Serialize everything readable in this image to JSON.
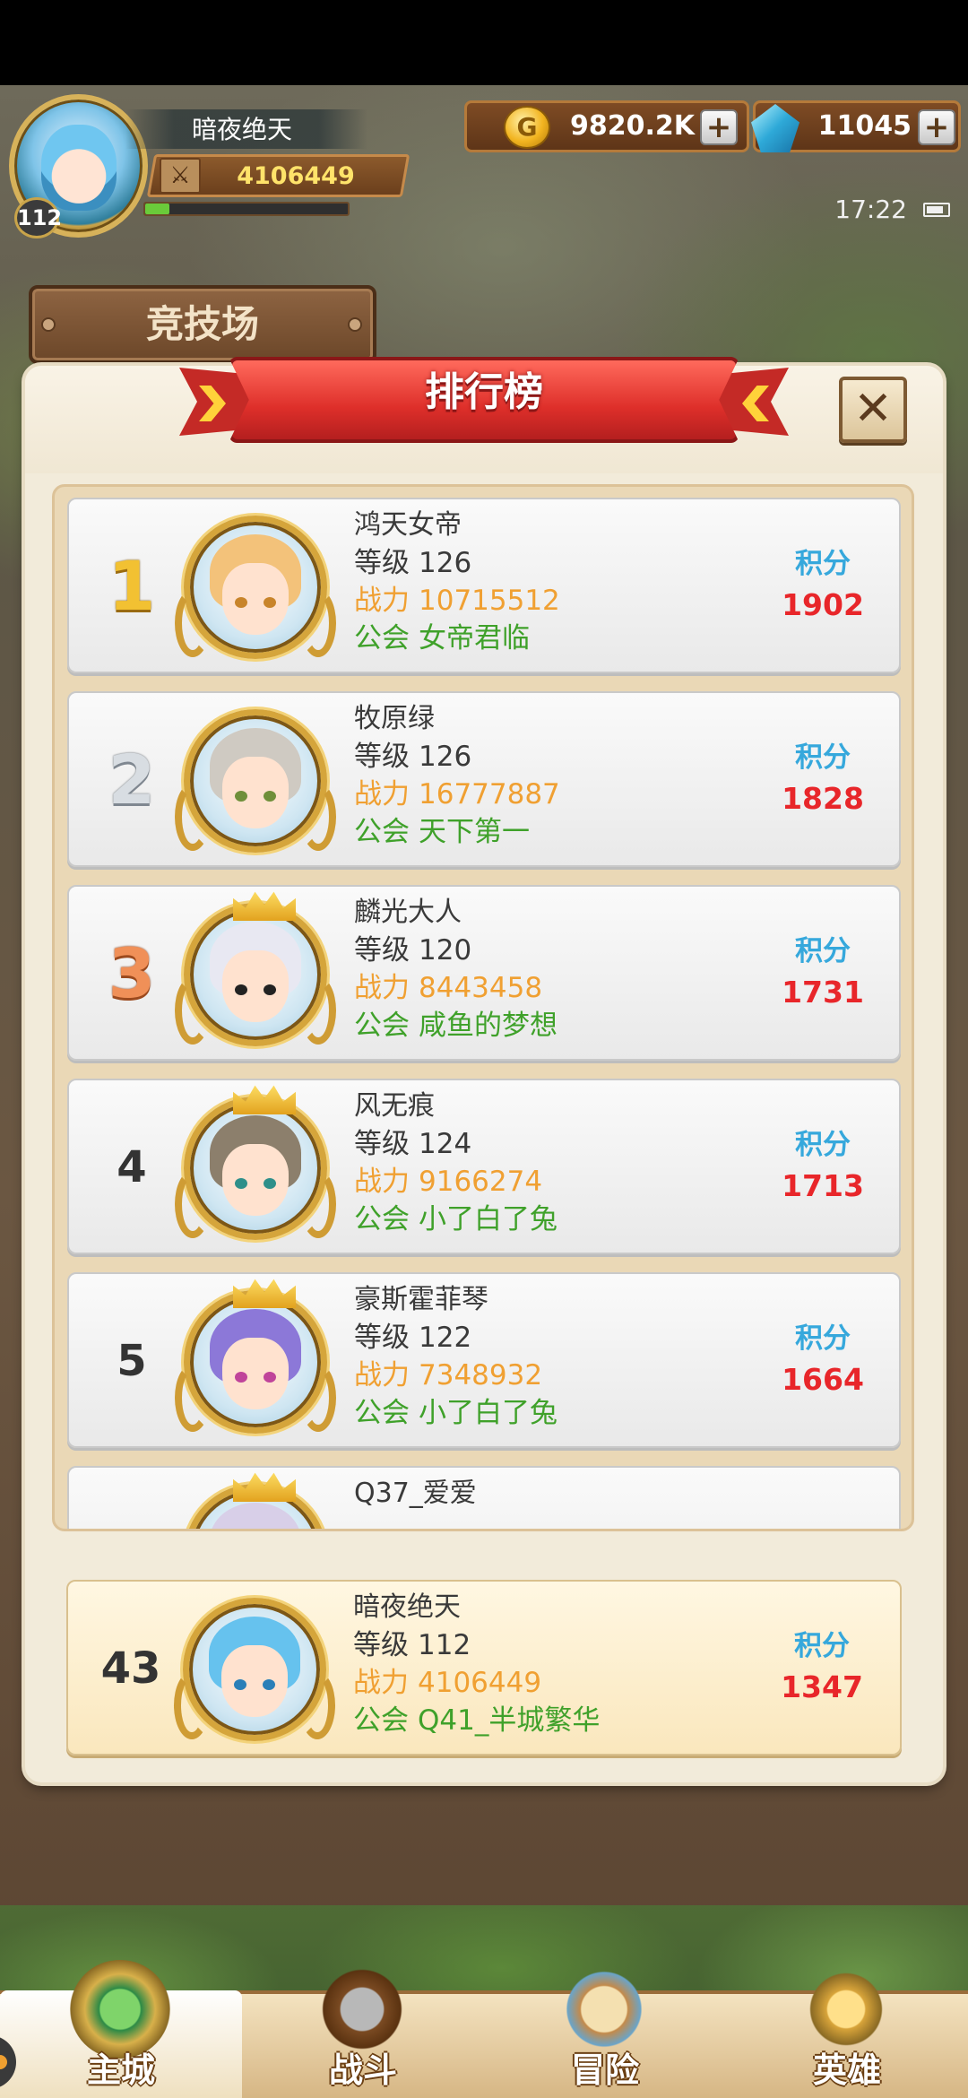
{
  "player": {
    "name": "暗夜绝天",
    "level": "112",
    "power": "4106449",
    "exp_progress": 0.12
  },
  "currency": {
    "gold": "9820.2K",
    "gems": "11045",
    "gold_icon_glyph": "G"
  },
  "status": {
    "time": "17:22"
  },
  "arena": {
    "title": "竞技场"
  },
  "modal": {
    "title": "排行榜",
    "close_glyph": "✕"
  },
  "labels": {
    "level": "等级",
    "power": "战力",
    "guild": "公会",
    "score": "积分"
  },
  "rankings": [
    {
      "rank": "1",
      "name": "鸿天女帝",
      "level": "126",
      "power": "10715512",
      "guild": "女帝君临",
      "score": "1902",
      "hair": "#f3c27a",
      "eye": "#c8842a"
    },
    {
      "rank": "2",
      "name": "牧原绿",
      "level": "126",
      "power": "16777887",
      "guild": "天下第一",
      "score": "1828",
      "hair": "#cfcac2",
      "eye": "#6f8f3a"
    },
    {
      "rank": "3",
      "name": "麟光大人",
      "level": "120",
      "power": "8443458",
      "guild": "咸鱼的梦想",
      "score": "1731",
      "hair": "#e8e8f2",
      "eye": "#222222"
    },
    {
      "rank": "4",
      "name": "风无痕",
      "level": "124",
      "power": "9166274",
      "guild": "小了白了兔",
      "score": "1713",
      "hair": "#8c7f6c",
      "eye": "#2e8f8a"
    },
    {
      "rank": "5",
      "name": "豪斯霍菲琴",
      "level": "122",
      "power": "7348932",
      "guild": "小了白了兔",
      "score": "1664",
      "hair": "#8c78d8",
      "eye": "#c0449a"
    },
    {
      "rank": "",
      "name": "Q37_爱爱",
      "level": "",
      "power": "",
      "guild": "",
      "score": "",
      "hair": "#d8cfe8",
      "eye": "#7a6ab0"
    }
  ],
  "my_rank": {
    "rank": "43",
    "name": "暗夜绝天",
    "level": "112",
    "power": "4106449",
    "guild": "Q41_半城繁华",
    "score": "1347",
    "hair": "#66c2ee",
    "eye": "#2a7fb8"
  },
  "nav": {
    "tabs": [
      "主城",
      "战斗",
      "冒险",
      "英雄"
    ],
    "active": "主城"
  }
}
